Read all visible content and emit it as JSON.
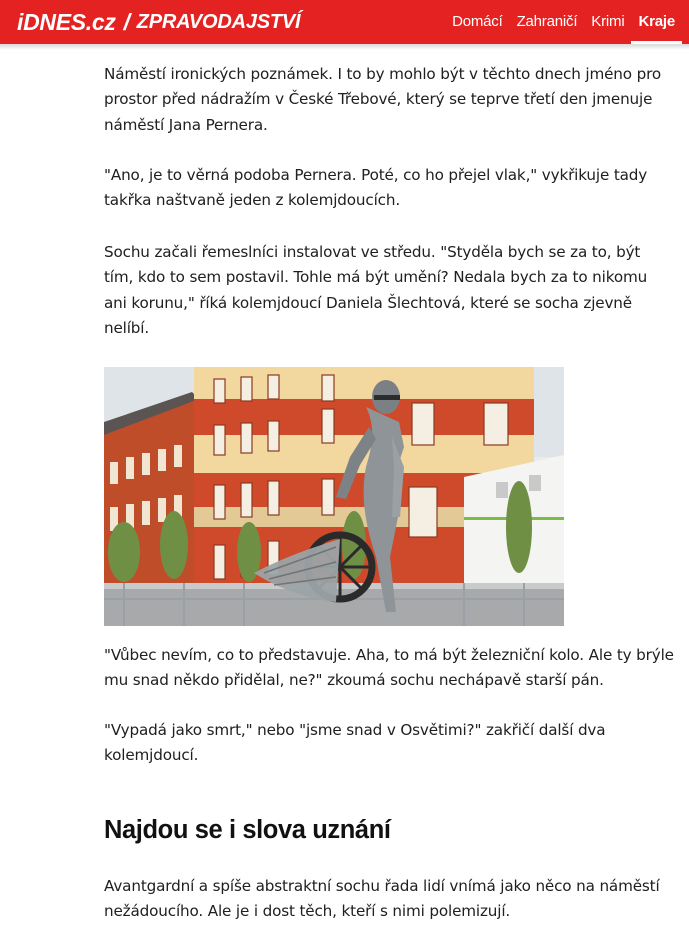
{
  "header": {
    "logo_main": "iDNES.cz",
    "logo_section": "ZPRAVODAJSTVÍ",
    "nav": [
      {
        "label": "Domácí"
      },
      {
        "label": "Zahraničí"
      },
      {
        "label": "Krimi"
      },
      {
        "label": "Kraje",
        "active": true
      }
    ],
    "brand_color": "#e52222"
  },
  "article": {
    "paragraphs": [
      "Náměstí ironických poznámek. I to by mohlo být v těchto dnech jméno pro prostor před nádražím v České Třebové, který se teprve třetí den jmenuje náměstí Jana Pernera.",
      "\"Ano, je to věrná podoba Pernera. Poté, co ho přejel vlak,\" vykřikuje tady takřka naštvaně jeden z kolemjdoucích.",
      "Sochu začali řemeslníci instalovat ve středu. \"Styděla bych se za to, být tím, kdo to sem postavil. Tohle má být umění? Nedala bych za to nikomu ani korunu,\" říká kolemjdoucí Daniela Šlechtová, které se socha zjevně nelíbí.",
      "\"Vůbec nevím, co to představuje. Aha, to má být železniční kolo. Ale ty brýle mu snad někdo přidělal, ne?\" zkoumá sochu nechápavě starší pán.",
      "\"Vypadá jako smrt,\" nebo \"jsme snad v Osvětimi?\" zakřičí další dva kolemjdoucí.",
      "Avantgardní a spíše abstraktní sochu řada lidí vnímá jako něco na náměstí nežádoucího. Ale je i dost těch, kteří s nimi polemizují."
    ],
    "subheading": "Najdou se i slova uznání"
  }
}
